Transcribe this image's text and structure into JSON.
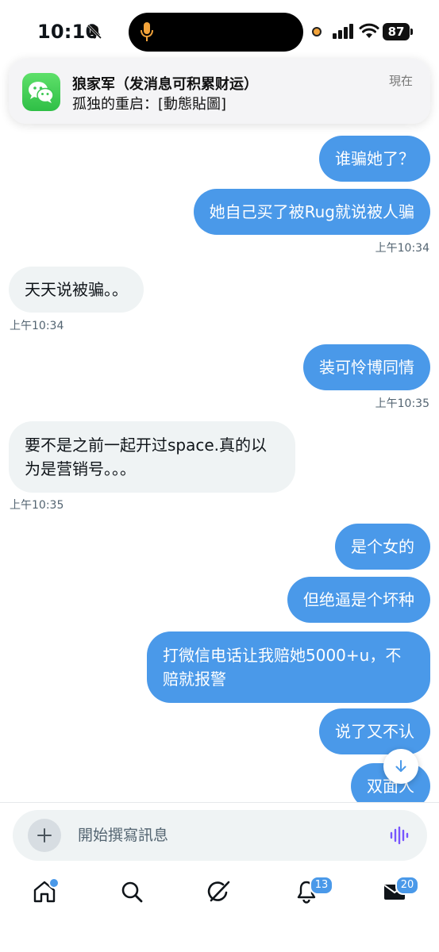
{
  "status_bar": {
    "time": "10:10",
    "battery": "87"
  },
  "notification": {
    "title": "狼家军（发消息可积累财运）",
    "body": "孤独的重启：[動態貼圖]",
    "time": "現在"
  },
  "messages": [
    {
      "side": "out",
      "text": "谁骗她了？"
    },
    {
      "side": "out",
      "text": "她自己买了被Rug就说被人骗",
      "timestamp": "上午10:34"
    },
    {
      "side": "in",
      "text": "天天说被骗。。",
      "timestamp": "上午10:34"
    },
    {
      "side": "out",
      "text": "装可怜博同情",
      "timestamp": "上午10:35"
    },
    {
      "side": "in",
      "text": "要不是之前一起开过space.真的以为是营销号。。。",
      "timestamp": "上午10:35"
    },
    {
      "side": "out",
      "text": "是个女的"
    },
    {
      "side": "out",
      "text": "但绝逼是个坏种"
    },
    {
      "side": "out",
      "text": "打微信电话让我赔她5000+u，不赔就报警"
    },
    {
      "side": "out",
      "text": "说了又不认"
    },
    {
      "side": "out",
      "text": "双面人"
    }
  ],
  "composer": {
    "placeholder": "開始撰寫訊息"
  },
  "tabs": [
    {
      "name": "home-icon"
    },
    {
      "name": "search-icon"
    },
    {
      "name": "grok-icon"
    },
    {
      "name": "notifications-icon",
      "badge": "13"
    },
    {
      "name": "messages-icon",
      "badge": "20"
    }
  ],
  "colors": {
    "accent": "#4a99e9",
    "incoming_bubble": "#eff3f4",
    "voice_icon": "#7856ff"
  }
}
